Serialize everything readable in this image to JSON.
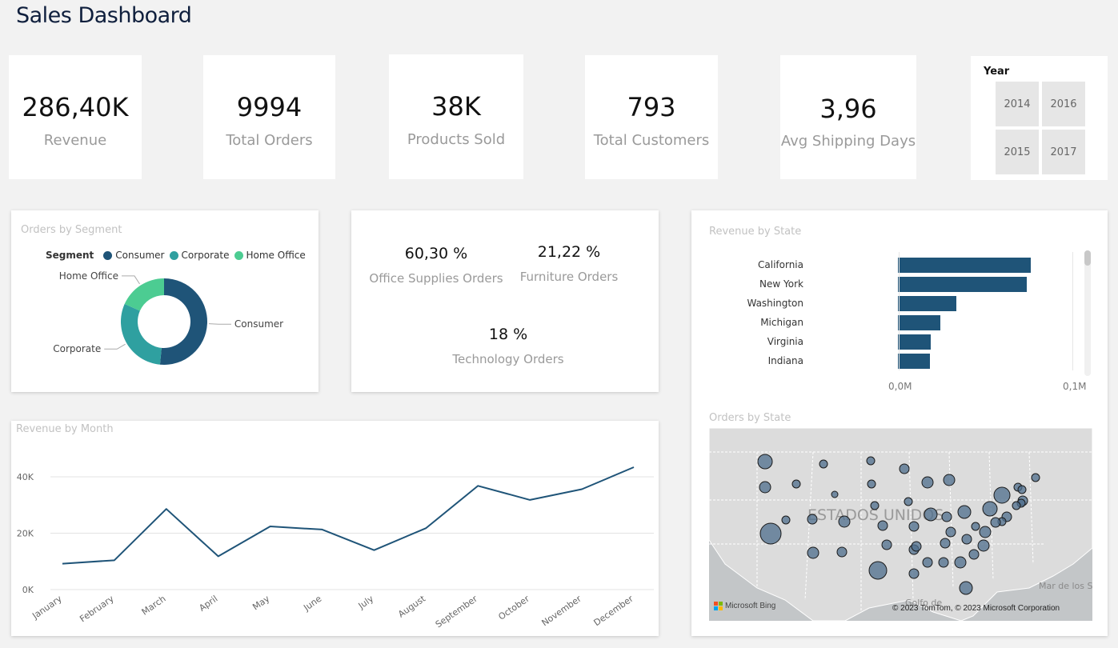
{
  "page": {
    "title": "Sales Dashboard"
  },
  "kpis": [
    {
      "value": "286,40K",
      "label": "Revenue"
    },
    {
      "value": "9994",
      "label": "Total Orders"
    },
    {
      "value": "38K",
      "label": "Products Sold"
    },
    {
      "value": "793",
      "label": "Total Customers"
    },
    {
      "value": "3,96",
      "label": "Avg Shipping Days"
    }
  ],
  "year_slicer": {
    "title": "Year",
    "options": [
      "2014",
      "2016",
      "2015",
      "2017"
    ]
  },
  "segment_chart": {
    "title": "Orders by Segment",
    "legend_title": "Segment",
    "colors": {
      "Consumer": "#1f5478",
      "Corporate": "#2fa0a0",
      "Home Office": "#4ccc92"
    },
    "chart_data": {
      "type": "pie",
      "variant": "donut",
      "categories": [
        "Consumer",
        "Corporate",
        "Home Office"
      ],
      "values": [
        51.5,
        30.2,
        18.3
      ],
      "title": "Orders by Segment",
      "legend": "top"
    }
  },
  "category_mix": {
    "items": [
      {
        "pct": "60,30 %",
        "label": "Office Supplies Orders"
      },
      {
        "pct": "21,22 %",
        "label": "Furniture Orders"
      },
      {
        "pct": "18 %",
        "label": "Technology Orders"
      }
    ]
  },
  "state_revenue": {
    "title": "Revenue by State",
    "color": "#1f5478",
    "chart_data": {
      "type": "bar",
      "orientation": "horizontal",
      "categories": [
        "California",
        "New York",
        "Washington",
        "Michigan",
        "Virginia",
        "Indiana"
      ],
      "values": [
        0.0765,
        0.074,
        0.0335,
        0.0245,
        0.019,
        0.0185
      ],
      "xlim": [
        0,
        0.1
      ],
      "x_ticks": [
        "0,0M",
        "0,1M"
      ],
      "title": "Revenue by State"
    }
  },
  "month_revenue": {
    "title": "Revenue by Month",
    "color": "#1f5478",
    "chart_data": {
      "type": "line",
      "categories": [
        "January",
        "February",
        "March",
        "April",
        "May",
        "June",
        "July",
        "August",
        "September",
        "October",
        "November",
        "December"
      ],
      "series": [
        {
          "values": [
            9200,
            10400,
            28600,
            11800,
            22400,
            21300,
            14000,
            21800,
            36800,
            31800,
            35600,
            43400
          ]
        }
      ],
      "ylim": [
        0,
        48000
      ],
      "y_ticks": [
        0,
        20000,
        40000
      ],
      "y_tick_labels": [
        "0K",
        "20K",
        "40K"
      ],
      "grid": true,
      "title": "Revenue by Month"
    }
  },
  "orders_map": {
    "title": "Orders by State",
    "country_label": "ESTADOS UNIDOS",
    "sea_label": "Mar de los Sar",
    "gulf_label": "Golfo de",
    "provider": "Microsoft Bing",
    "copyright": "© 2023 TomTom, © 2023 Microsoft Corporation",
    "bubble_color": "#4d6d8c",
    "land_color": "#dcdcdc",
    "water_color": "#c3c6c8"
  }
}
